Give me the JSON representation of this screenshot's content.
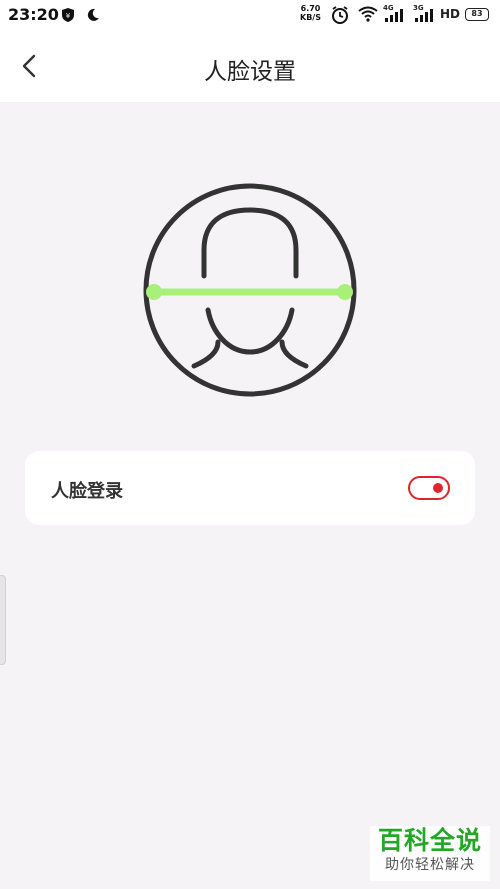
{
  "status_bar": {
    "time": "23:20",
    "net_speed_value": "6.70",
    "net_speed_unit": "KB/S",
    "network_1": "4G",
    "network_2": "3G",
    "hd": "HD",
    "battery": "83",
    "icons": [
      "shield-icon",
      "moon-icon",
      "alarm-icon",
      "wifi-icon",
      "signal-icon",
      "signal-icon",
      "battery-icon"
    ]
  },
  "header": {
    "title": "人脸设置",
    "back_icon": "chevron-left-icon"
  },
  "illustration": {
    "icon": "face-scan-icon",
    "scan_line_color": "#a8f07a",
    "stroke_color": "#333333"
  },
  "settings": {
    "face_login_label": "人脸登录",
    "face_login_enabled": true,
    "toggle_color": "#e0242c"
  },
  "watermark": {
    "title": "百科全说",
    "subtitle": "助你轻松解决"
  }
}
